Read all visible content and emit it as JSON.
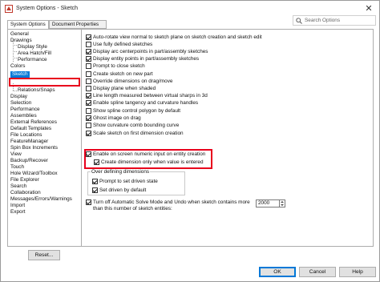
{
  "window": {
    "title": "System Options - Sketch"
  },
  "tabs": [
    {
      "label": "System Options"
    },
    {
      "label": "Document Properties"
    }
  ],
  "search": {
    "placeholder": "Search Options"
  },
  "tree": {
    "items": [
      {
        "label": "General"
      },
      {
        "label": "Drawings"
      },
      {
        "label": "Display Style"
      },
      {
        "label": "Area Hatch/Fill"
      },
      {
        "label": "Performance"
      },
      {
        "label": "Colors"
      },
      {
        "label": "Sketch"
      },
      {
        "label": "Relations/Snaps"
      },
      {
        "label": "Display"
      },
      {
        "label": "Selection"
      },
      {
        "label": "Performance"
      },
      {
        "label": "Assemblies"
      },
      {
        "label": "External References"
      },
      {
        "label": "Default Templates"
      },
      {
        "label": "File Locations"
      },
      {
        "label": "FeatureManager"
      },
      {
        "label": "Spin Box Increments"
      },
      {
        "label": "View"
      },
      {
        "label": "Backup/Recover"
      },
      {
        "label": "Touch"
      },
      {
        "label": "Hole Wizard/Toolbox"
      },
      {
        "label": "File Explorer"
      },
      {
        "label": "Search"
      },
      {
        "label": "Collaboration"
      },
      {
        "label": "Messages/Errors/Warnings"
      },
      {
        "label": "Import"
      },
      {
        "label": "Export"
      }
    ],
    "selected": "Sketch"
  },
  "options": [
    {
      "label": "Auto-rotate view normal to sketch plane on sketch creation and sketch edit",
      "checked": true
    },
    {
      "label": "Use fully defined sketches",
      "checked": false
    },
    {
      "label": "Display arc centerpoints in part/assembly sketches",
      "checked": true
    },
    {
      "label": "Display entity points in part/assembly sketches",
      "checked": true
    },
    {
      "label": "Prompt to close sketch",
      "checked": false
    },
    {
      "label": "Create sketch on new part",
      "checked": false
    },
    {
      "label": "Override dimensions on drag/move",
      "checked": false
    },
    {
      "label": "Display plane when shaded",
      "checked": false
    },
    {
      "label": "Line length measured between virtual sharps in 3d",
      "checked": true
    },
    {
      "label": "Enable spline tangency and curvature handles",
      "checked": true
    },
    {
      "label": "Show spline control polygon by default",
      "checked": false
    },
    {
      "label": "Ghost image on drag",
      "checked": true
    },
    {
      "label": "Show curvature comb bounding curve",
      "checked": false
    },
    {
      "label": "Scale sketch on first dimension creation",
      "checked": true
    },
    {
      "label": "Enable on screen numeric input on entity creation",
      "checked": true
    },
    {
      "label": "Create dimension only when value is entered",
      "checked": true
    }
  ],
  "over_defining": {
    "title": "Over defining dimensions",
    "prompt": {
      "label": "Prompt to set driven state",
      "checked": true
    },
    "driven": {
      "label": "Set driven by default",
      "checked": true
    }
  },
  "auto_solve": {
    "label_line1": "Turn off Automatic Solve Mode and Undo when sketch contains more",
    "label_line2": "than this number of sketch entities:",
    "checked": true,
    "value": "2000"
  },
  "buttons": {
    "reset": "Reset...",
    "ok": "OK",
    "cancel": "Cancel",
    "help": "Help"
  },
  "colors": {
    "highlight_red": "#e8001c",
    "selection_blue": "#0078d7"
  }
}
